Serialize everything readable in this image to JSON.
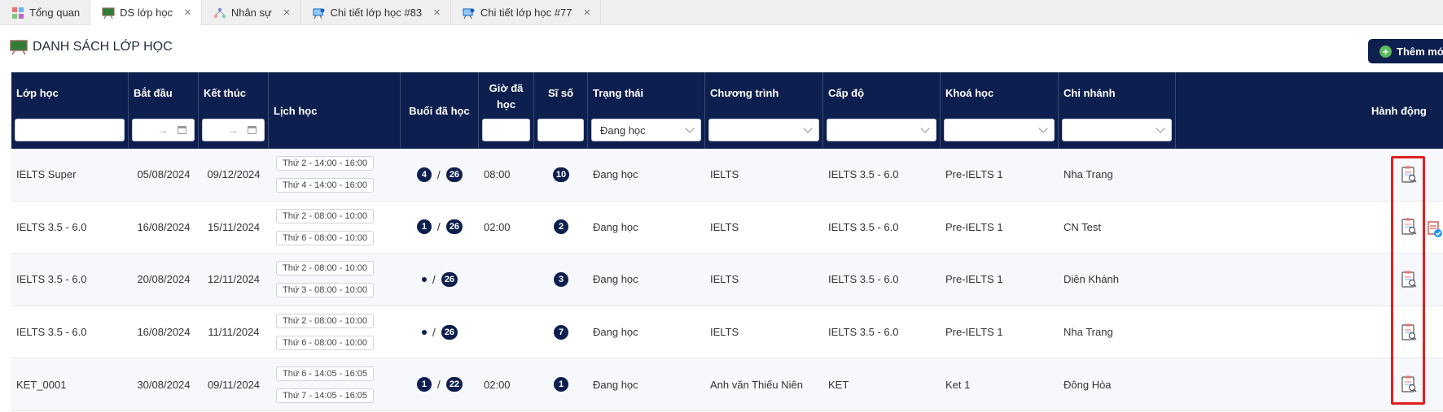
{
  "tabs": [
    {
      "label": "Tổng quan",
      "icon": "dashboard-icon",
      "closable": false,
      "active": false
    },
    {
      "label": "DS lớp học",
      "icon": "classroom-board-icon",
      "closable": true,
      "active": true
    },
    {
      "label": "Nhân sự",
      "icon": "org-chart-icon",
      "closable": true,
      "active": false
    },
    {
      "label": "Chi tiết lớp học #83",
      "icon": "class-detail-icon",
      "closable": true,
      "active": false
    },
    {
      "label": "Chi tiết lớp học #77",
      "icon": "class-detail-icon",
      "closable": true,
      "active": false
    }
  ],
  "page": {
    "title": "DANH SÁCH LỚP HỌC",
    "add_button_label": "Thêm mới"
  },
  "columns": {
    "lop_hoc": "Lớp học",
    "bat_dau": "Bắt đầu",
    "ket_thuc": "Kết thúc",
    "lich_hoc": "Lịch học",
    "buoi_da_hoc": "Buổi đã học",
    "gio_da_hoc_1": "Giờ đã",
    "gio_da_hoc_2": "học",
    "si_so": "Sĩ số",
    "trang_thai": "Trạng thái",
    "chuong_trinh": "Chương trình",
    "cap_do": "Cấp độ",
    "khoa_hoc": "Khoá học",
    "chi_nhanh": "Chi nhánh",
    "hanh_dong": "Hành động"
  },
  "filters": {
    "date_arrow": "→",
    "trang_thai_value": "Đang học"
  },
  "rows": [
    {
      "name": "IELTS Super",
      "start": "05/08/2024",
      "end": "09/12/2024",
      "schedule": [
        "Thứ 2 - 14:00 - 16:00",
        "Thứ 4 - 14:00 - 16:00"
      ],
      "done": "4",
      "total": "26",
      "hours": "08:00",
      "size": "10",
      "status": "Đang học",
      "program": "IELTS",
      "level": "IELTS 3.5 - 6.0",
      "course": "Pre-IELTS 1",
      "branch": "Nha Trang"
    },
    {
      "name": "IELTS 3.5 - 6.0",
      "start": "16/08/2024",
      "end": "15/11/2024",
      "schedule": [
        "Thứ 2 - 08:00 - 10:00",
        "Thứ 6 - 08:00 - 10:00"
      ],
      "done": "1",
      "total": "26",
      "hours": "02:00",
      "size": "2",
      "status": "Đang học",
      "program": "IELTS",
      "level": "IELTS 3.5 - 6.0",
      "course": "Pre-IELTS 1",
      "branch": "CN Test"
    },
    {
      "name": "IELTS 3.5 - 6.0",
      "start": "20/08/2024",
      "end": "12/11/2024",
      "schedule": [
        "Thứ 2 - 08:00 - 10:00",
        "Thứ 3 - 08:00 - 10:00"
      ],
      "done": "",
      "total": "26",
      "hours": "",
      "size": "3",
      "status": "Đang học",
      "program": "IELTS",
      "level": "IELTS 3.5 - 6.0",
      "course": "Pre-IELTS 1",
      "branch": "Diên Khánh"
    },
    {
      "name": "IELTS 3.5 - 6.0",
      "start": "16/08/2024",
      "end": "11/11/2024",
      "schedule": [
        "Thứ 2 - 08:00 - 10:00",
        "Thứ 6 - 08:00 - 10:00"
      ],
      "done": "",
      "total": "26",
      "hours": "",
      "size": "7",
      "status": "Đang học",
      "program": "IELTS",
      "level": "IELTS 3.5 - 6.0",
      "course": "Pre-IELTS 1",
      "branch": "Nha Trang"
    },
    {
      "name": "KET_0001",
      "start": "30/08/2024",
      "end": "09/11/2024",
      "schedule": [
        "Thứ 6 - 14:05 - 16:05",
        "Thứ 7 - 14:05 - 16:05"
      ],
      "done": "1",
      "total": "22",
      "hours": "02:00",
      "size": "1",
      "status": "Đang học",
      "program": "Anh văn Thiếu Niên",
      "level": "KET",
      "course": "Ket 1",
      "branch": "Đông Hòa"
    }
  ]
}
